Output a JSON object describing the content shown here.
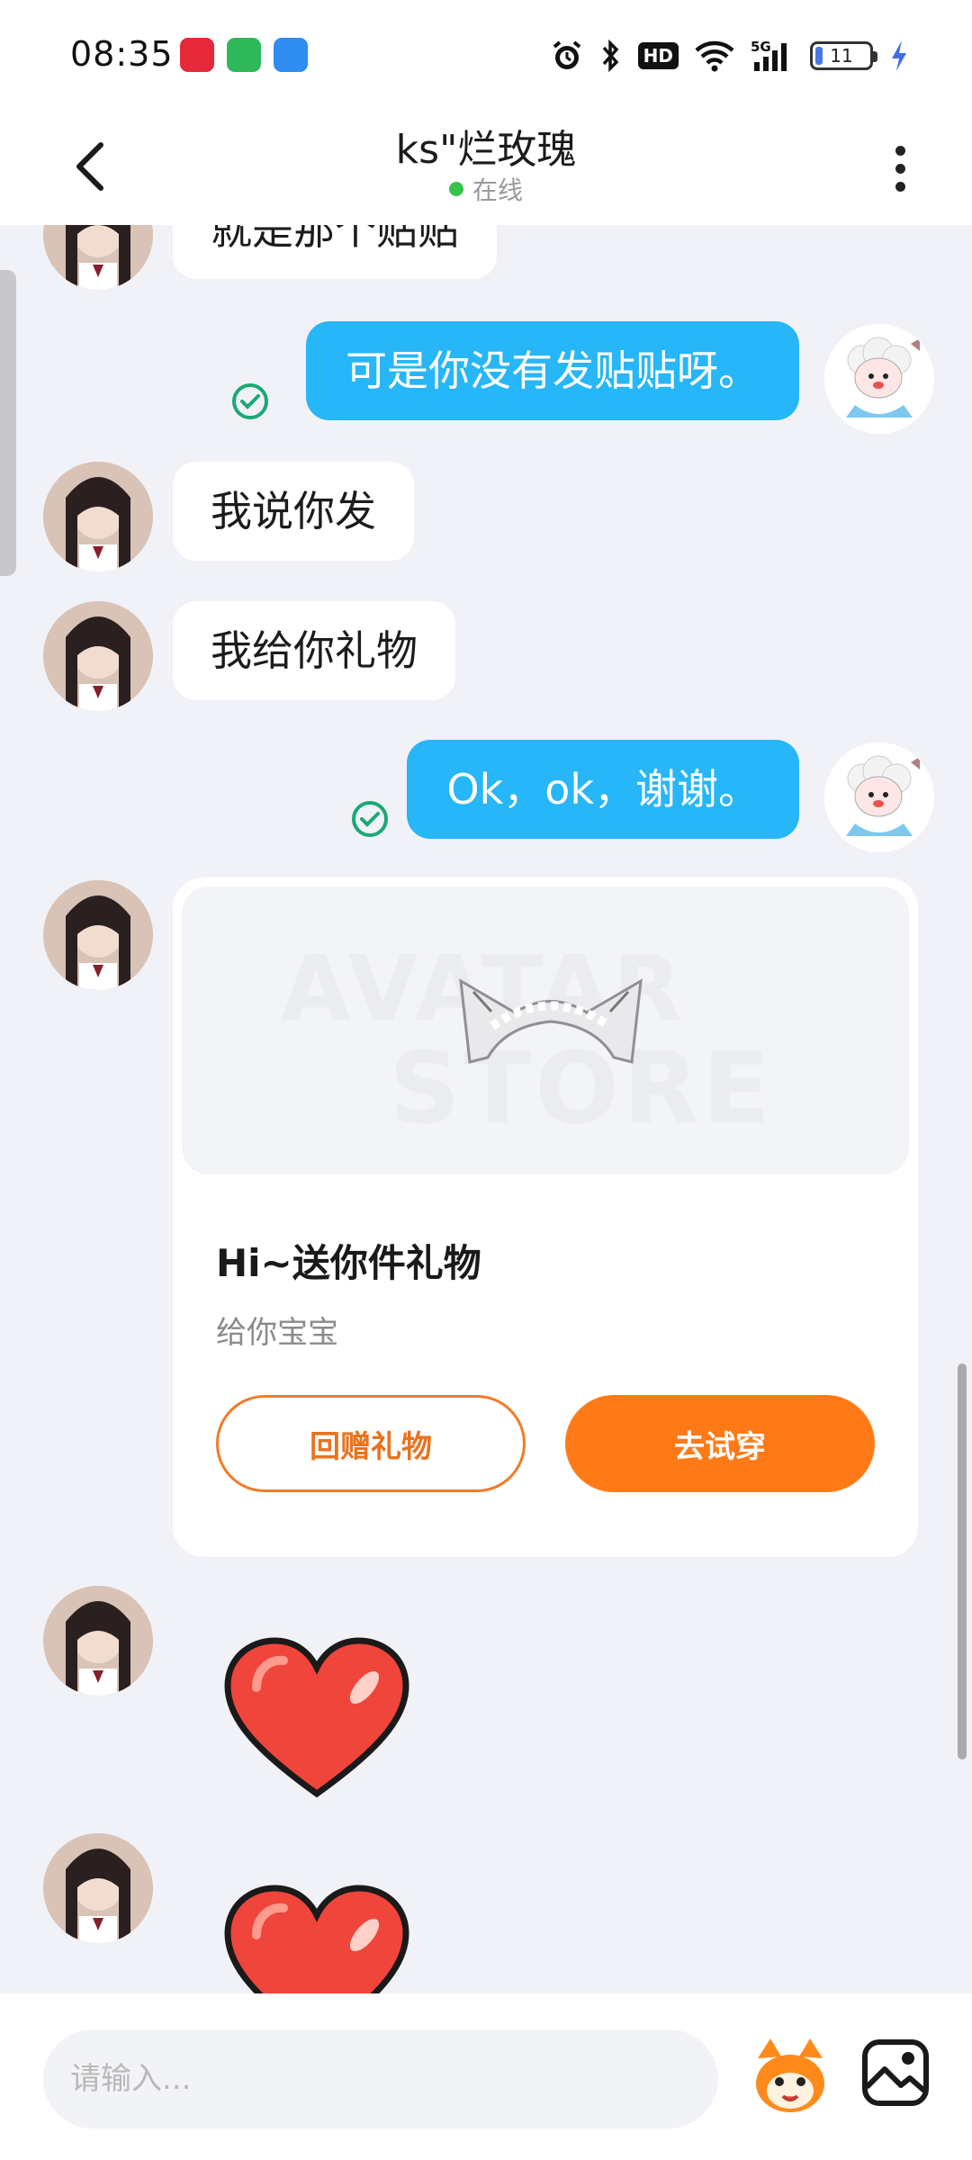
{
  "status_bar": {
    "time": "08:35",
    "battery": "11",
    "icons": [
      "alarm-icon",
      "bluetooth-icon",
      "hd-icon",
      "wifi-icon",
      "5g-signal-icon",
      "battery-icon",
      "charging-icon"
    ],
    "hd_label": "HD"
  },
  "header": {
    "title": "ks\"烂玫瑰",
    "status": "在线",
    "status_color": "#38c24b"
  },
  "messages": [
    {
      "side": "in",
      "text": "就是那个贴贴"
    },
    {
      "side": "out",
      "text": "可是你没有发贴贴呀。",
      "read": true
    },
    {
      "side": "in",
      "text": "我说你发"
    },
    {
      "side": "in",
      "text": "我给你礼物"
    },
    {
      "side": "out",
      "text": "Ok，ok，谢谢。",
      "read": true
    }
  ],
  "gift_card": {
    "watermark_1": "AVATAR",
    "watermark_2": "STORE",
    "title": "Hi~送你件礼物",
    "subtitle": "给你宝宝",
    "return_label": "回赠礼物",
    "try_label": "去试穿",
    "accent": "#ff7a17"
  },
  "stickers": [
    "heart-sticker",
    "heart-sticker"
  ],
  "input": {
    "placeholder": "请输入..."
  },
  "colors": {
    "outgoing_bubble": "#27b6f7",
    "background": "#f1f2f7"
  }
}
